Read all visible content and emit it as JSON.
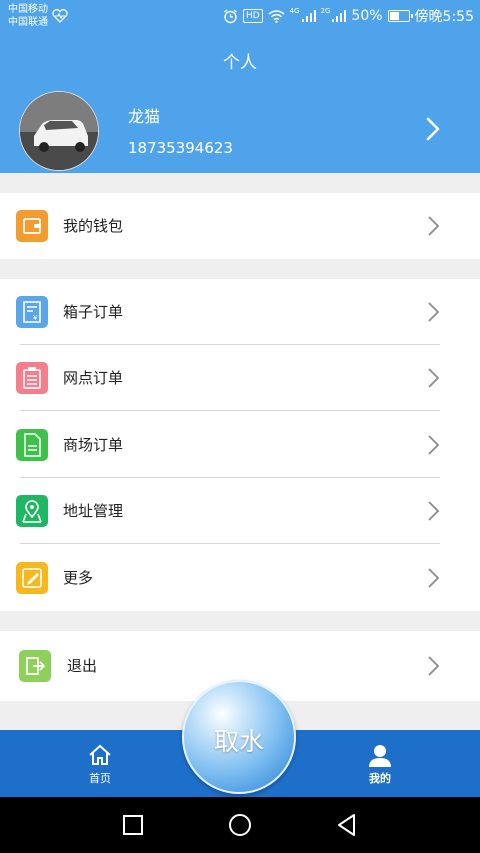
{
  "status_bar": {
    "carrier1": "中国移动",
    "carrier2": "中国联通",
    "network1": "4G",
    "network2": "2G",
    "battery": "50%",
    "battery_level": 0.5,
    "time": "傍晚5:55",
    "hd": "HD"
  },
  "header": {
    "title": "个人",
    "username": "龙猫",
    "phone": "18735394623"
  },
  "menu": {
    "wallet": "我的钱包",
    "box_orders": "箱子订单",
    "outlet_orders": "网点订单",
    "mall_orders": "商场订单",
    "address": "地址管理",
    "more": "更多",
    "logout": "退出"
  },
  "tabbar": {
    "home": "首页",
    "center": "取水",
    "mine": "我的"
  },
  "colors": {
    "header": "#4fa3ea",
    "tabbar": "#1e6fca",
    "wallet_icon": "#f39c30",
    "box_icon": "#5aa6e8",
    "outlet_icon": "#f47f8c",
    "mall_icon": "#3ec14a",
    "address_icon": "#1fb664",
    "more_icon": "#f5b81e",
    "logout_icon": "#8ed05a"
  }
}
